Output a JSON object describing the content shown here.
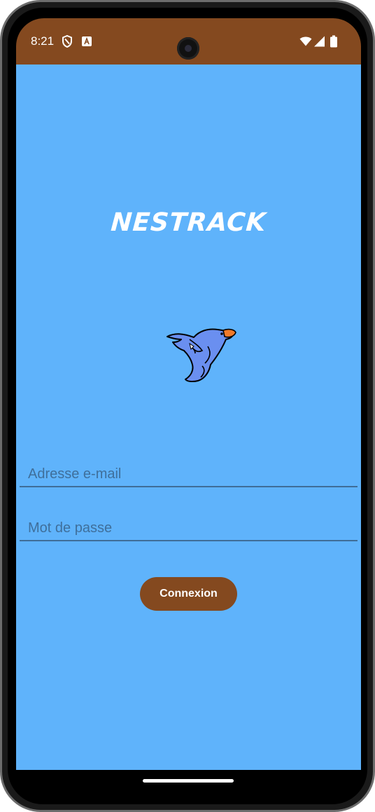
{
  "status_bar": {
    "time": "8:21",
    "background_color": "#84491f",
    "icons": [
      "shield-icon",
      "app-a-icon",
      "camera-cutout",
      "wifi-icon",
      "signal-icon",
      "battery-icon"
    ]
  },
  "app": {
    "background_color": "#5fb3fb",
    "title": "NESTRACK",
    "logo": "bird-logo-icon"
  },
  "form": {
    "email_placeholder": "Adresse e-mail",
    "password_placeholder": "Mot de passe",
    "login_label": "Connexion",
    "button_color": "#84491f"
  }
}
